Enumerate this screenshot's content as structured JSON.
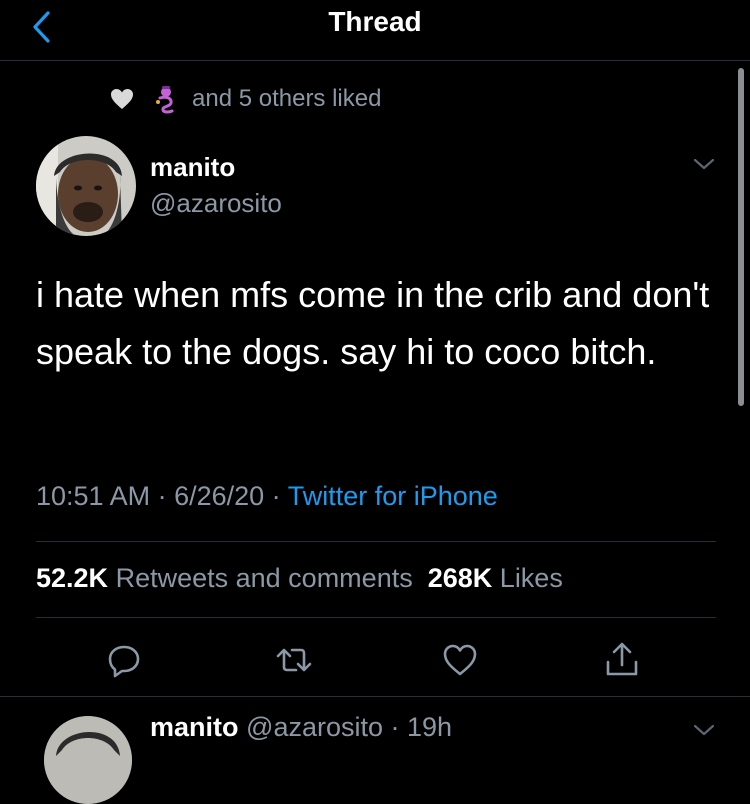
{
  "header": {
    "title": "Thread"
  },
  "liked": {
    "text": "and 5 others liked"
  },
  "tweet": {
    "name": "manito",
    "handle": "@azarosito",
    "text": "i hate when mfs come in the crib and don't speak to the dogs. say hi to coco bitch.",
    "time": "10:51 AM",
    "date": "6/26/20",
    "source": "Twitter for iPhone",
    "retweets_count": "52.2K",
    "retweets_label": "Retweets and comments",
    "likes_count": "268K",
    "likes_label": "Likes"
  },
  "reply": {
    "name": "manito",
    "handle": "@azarosito",
    "time": "19h"
  },
  "icons": [
    "back-chevron-icon",
    "heart-icon",
    "genie-emoji-icon",
    "caret-down-icon",
    "reply-icon",
    "retweet-icon",
    "like-icon",
    "share-icon"
  ],
  "colors": {
    "background": "#000000",
    "accent": "#1d9bf0",
    "secondary_text": "#8b98a5",
    "divider": "#2a2d31"
  }
}
